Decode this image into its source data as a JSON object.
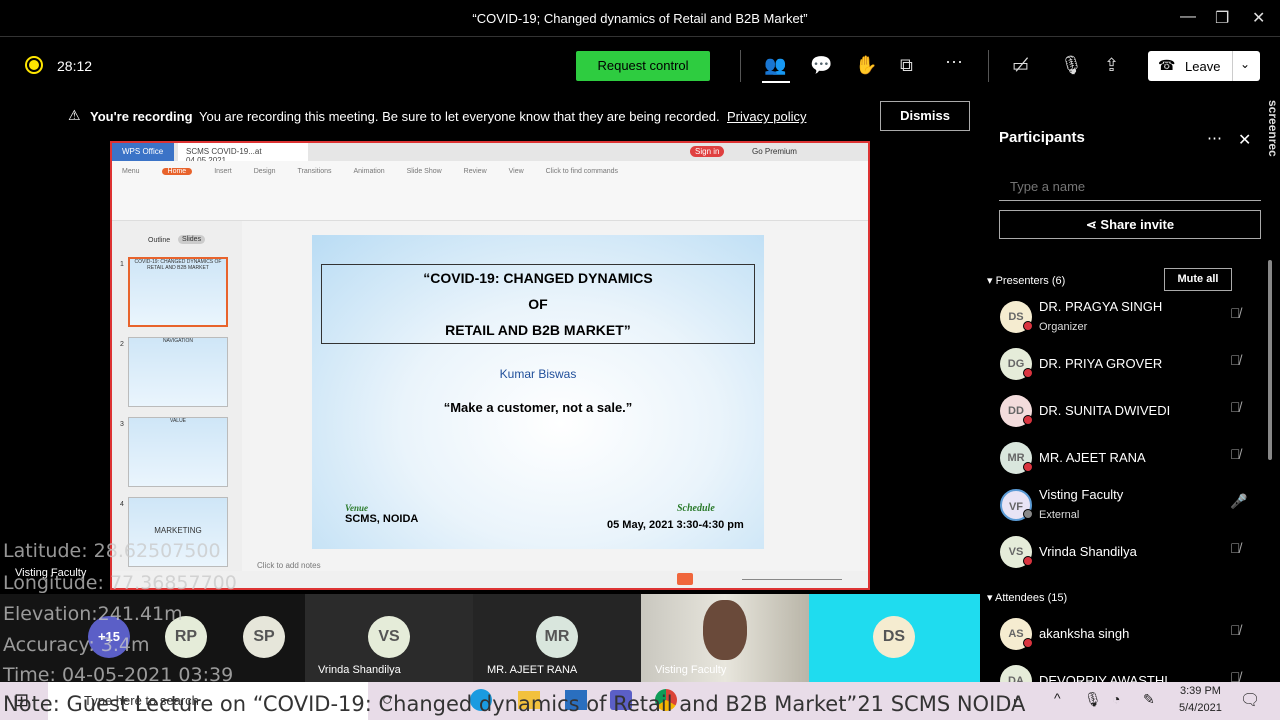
{
  "window": {
    "title": "“COVID-19; Changed dynamics of Retail and B2B Market”",
    "minimize": "—",
    "maximize": "❐",
    "close": "✕"
  },
  "toolbar": {
    "timer": "28:12",
    "request_control": "Request control",
    "leave": "Leave",
    "icons": [
      "people-icon",
      "chat-icon",
      "raise-hand-icon",
      "rooms-icon",
      "more-icon",
      "camera-off-icon",
      "mic-off-icon",
      "share-icon"
    ]
  },
  "banner": {
    "bold": "You're recording",
    "text": "You are recording this meeting. Be sure to let everyone know that they are being recorded.",
    "link": "Privacy policy",
    "dismiss": "Dismiss"
  },
  "wps": {
    "app_tab": "WPS Office",
    "doc_tab": "SCMS COVID-19...at 04.05.2021",
    "sign_in": "Sign in",
    "premium": "Go Premium",
    "menu": [
      "Menu",
      "Home",
      "Insert",
      "Design",
      "Transitions",
      "Animation",
      "Slide Show",
      "Review",
      "View"
    ],
    "find": "Click to find commands",
    "outline": "Outline",
    "slides": "Slides",
    "notes": "Click to add notes",
    "thumbs": [
      {
        "num": "1",
        "text": "COVID-19: CHANGED DYNAMICS OF RETAIL AND B2B MARKET"
      },
      {
        "num": "2",
        "text": "NAVIGATION"
      },
      {
        "num": "3",
        "text": "VALUE"
      },
      {
        "num": "4",
        "text": "MARKETING"
      }
    ],
    "slide": {
      "title1": "“COVID-19: CHANGED DYNAMICS",
      "title2": "OF",
      "title3": "RETAIL AND B2B MARKET”",
      "author": "Kumar Biswas",
      "quote": "“Make a customer, not a sale.”",
      "venue_label": "Venue",
      "venue": "SCMS, NOIDA",
      "schedule_label": "Schedule",
      "schedule": "05 May, 2021 3:30-4:30 pm"
    }
  },
  "strip": {
    "self_label": "Visting Faculty",
    "more": "+15",
    "avatars": [
      "RP",
      "SP"
    ],
    "tiles": [
      {
        "initials": "VS",
        "name": "Vrinda Shandilya"
      },
      {
        "initials": "MR",
        "name": "MR. AJEET RANA"
      }
    ],
    "video_name": "Visting Faculty",
    "ds": "DS"
  },
  "panel": {
    "title": "Participants",
    "search_placeholder": "Type a name",
    "share_invite": "Share invite",
    "presenters_label": "Presenters (6)",
    "mute_all": "Mute all",
    "attendees_label": "Attendees (15)",
    "presenters": [
      {
        "initials": "DS",
        "name": "DR. PRAGYA SINGH",
        "sub": "Organizer",
        "color": "#f5ecd0"
      },
      {
        "initials": "DG",
        "name": "DR. PRIYA GROVER",
        "sub": "",
        "color": "#e5ecd9"
      },
      {
        "initials": "DD",
        "name": "DR. SUNITA DWIVEDI",
        "sub": "",
        "color": "#f3dcdc"
      },
      {
        "initials": "MR",
        "name": "MR. AJEET RANA",
        "sub": "",
        "color": "#d9e6dd"
      },
      {
        "initials": "VF",
        "name": "Visting Faculty",
        "sub": "External",
        "color": "#e8e4f5"
      },
      {
        "initials": "VS",
        "name": "Vrinda Shandilya",
        "sub": "",
        "color": "#e5ecd9"
      }
    ],
    "attendees": [
      {
        "initials": "AS",
        "name": "akanksha singh",
        "color": "#f5ecd0"
      },
      {
        "initials": "DA",
        "name": "DEVORRIY AWASTHI",
        "color": "#e5ecd9"
      }
    ]
  },
  "screenrec": "screenrec",
  "overlay": {
    "latitude": "Latitude: 28.62507500",
    "longitude": "Longitude: 77.36857700",
    "elevation": "Elevation:241.41m",
    "accuracy": "Accuracy: 3.4m",
    "time": "Time: 04-05-2021  03:39"
  },
  "taskbar": {
    "search": "Type here to search",
    "time": "3:39 PM",
    "date": "5/4/2021"
  },
  "note": "Note: Guest Lecture on “COVID-19: Changed dynamics of Retail and B2B Market”21 SCMS NOIDA"
}
